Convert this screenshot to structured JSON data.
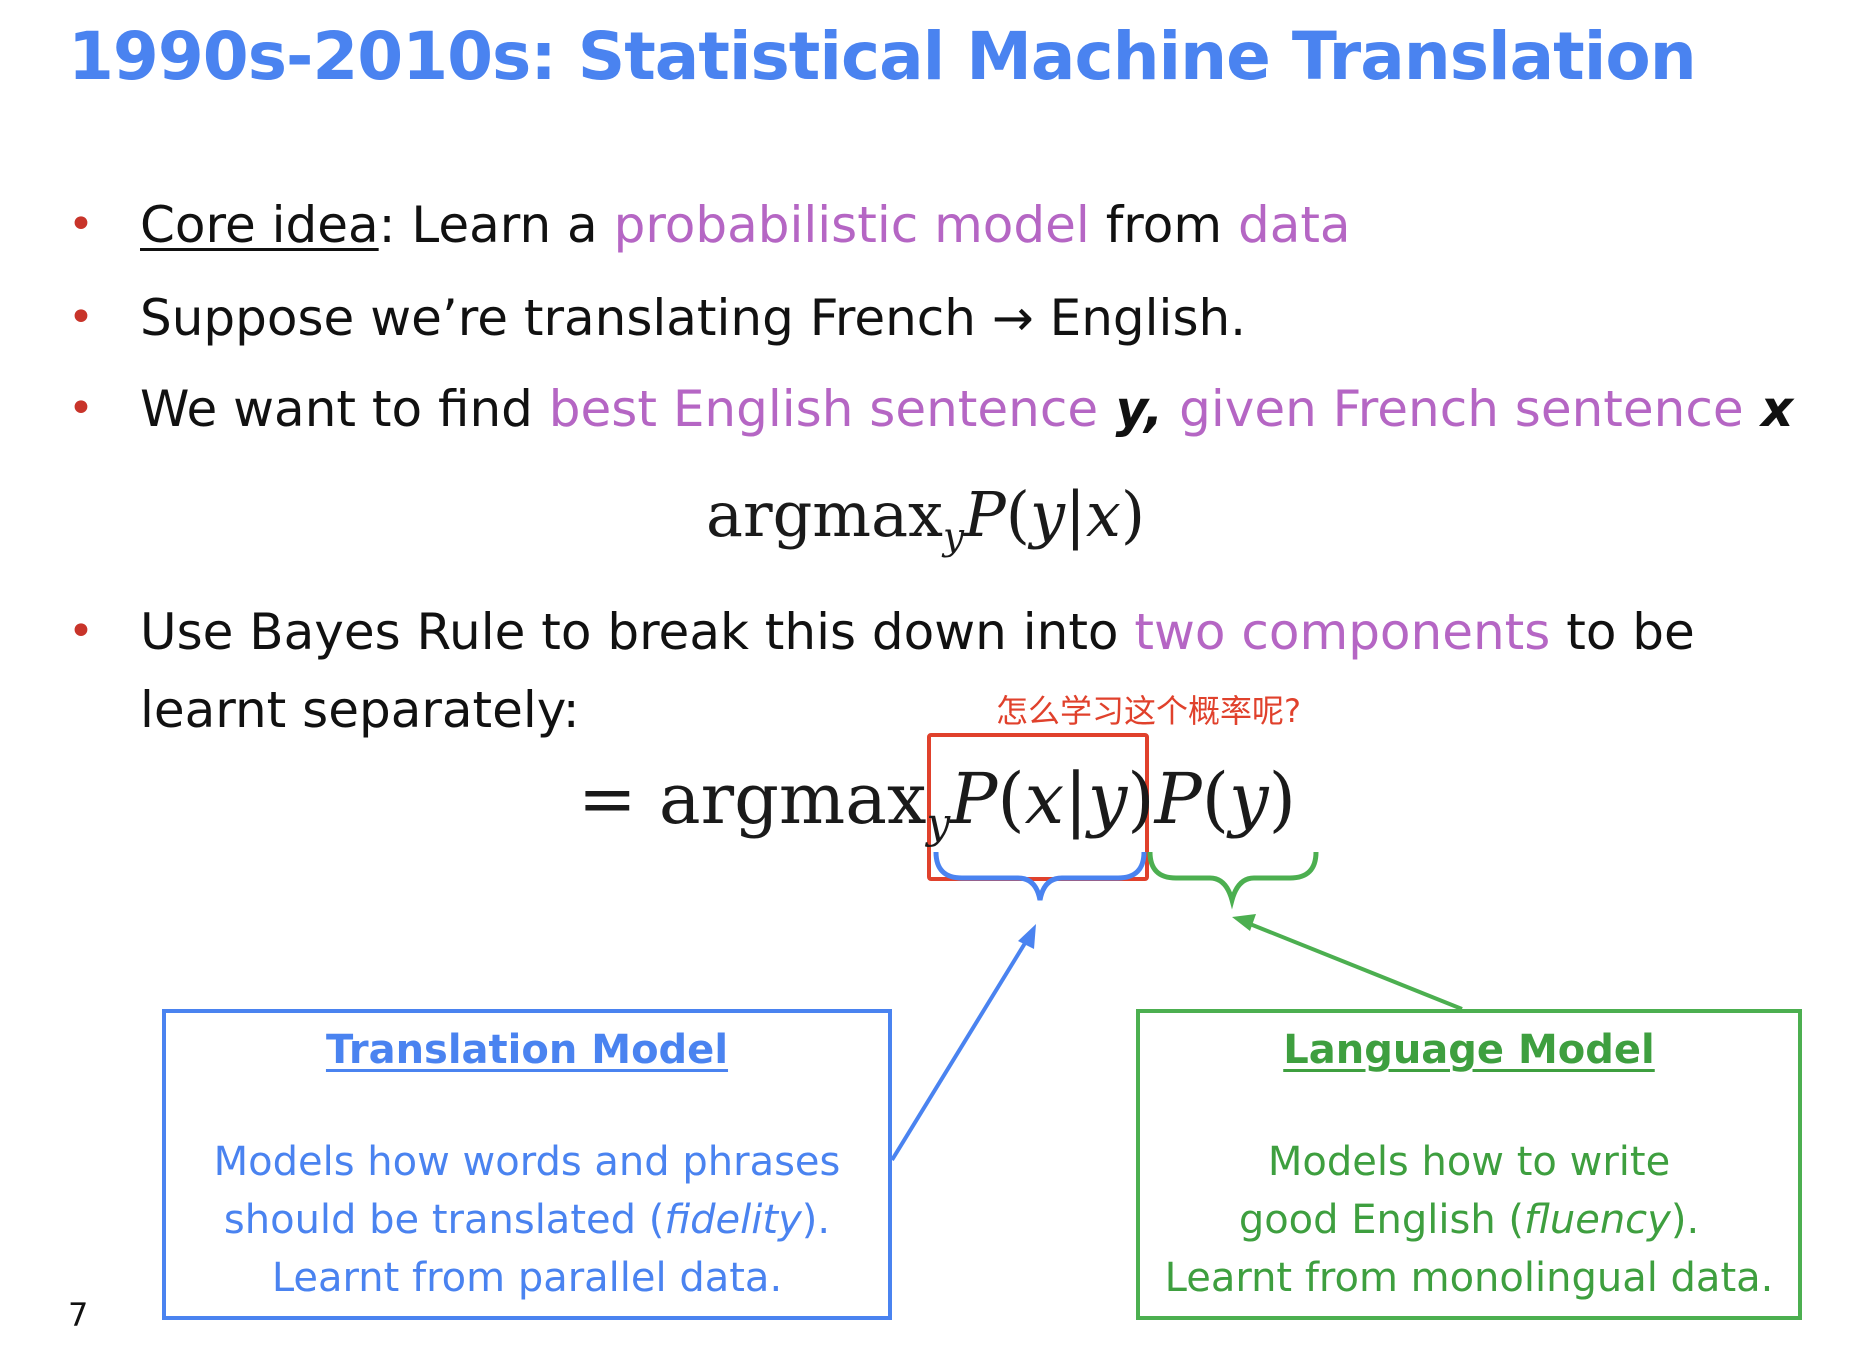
{
  "slide": {
    "title": "1990s-2010s: Statistical Machine Translation",
    "page_number": "7"
  },
  "bullets": [
    {
      "marker": "•",
      "core_label": "Core idea",
      "core_colon": ":",
      "p1": " Learn a ",
      "h1": "probabilistic model",
      "p2": " from ",
      "h2": "data"
    },
    {
      "marker": "•",
      "text": "Suppose we’re translating French → English."
    },
    {
      "marker": "•",
      "p1": "We want to find ",
      "h1": "best English sentence",
      "var_y": " y,",
      "h2": " given French sentence",
      "var_x": " x"
    },
    {
      "marker": "•",
      "p1": "Use Bayes Rule to break this down into ",
      "h1": "two components",
      "p2": " to be",
      "line2": "learnt separately:"
    }
  ],
  "formulas": {
    "f1_op": "argmax",
    "f1_sub": "y",
    "f1_P": "P",
    "f1_paren_open": "(",
    "f1_y": "y",
    "f1_bar": "|",
    "f1_x": "x",
    "f1_paren_close": ")",
    "f2_eq": "=",
    "f2_op": "argmax",
    "f2_sub": "y",
    "f2_P1": "P",
    "f2_open1": "(",
    "f2_x": "x",
    "f2_bar": "|",
    "f2_y": "y",
    "f2_close1": ")",
    "f2_P2": "P",
    "f2_open2": "(",
    "f2_y2": "y",
    "f2_close2": ")"
  },
  "annotation": {
    "note": "怎么学习这个概率呢?"
  },
  "translation_model": {
    "title": "Translation Model",
    "line1": "Models how words and phrases",
    "line2_a": "should be translated (",
    "line2_em": "fidelity",
    "line2_b": ").",
    "line3": "Learnt from parallel data."
  },
  "language_model": {
    "title": "Language Model",
    "line1": "Models how to write",
    "line2_a": "good English (",
    "line2_em": "fluency",
    "line2_b": ").",
    "line3": "Learnt from monolingual data."
  },
  "colors": {
    "title": "#4a83f0",
    "bullet_marker": "#c8342a",
    "highlight_purple": "#b566c4",
    "translation_blue": "#4a83f0",
    "language_green": "#4caf50",
    "annotation_red": "#e0412c"
  }
}
